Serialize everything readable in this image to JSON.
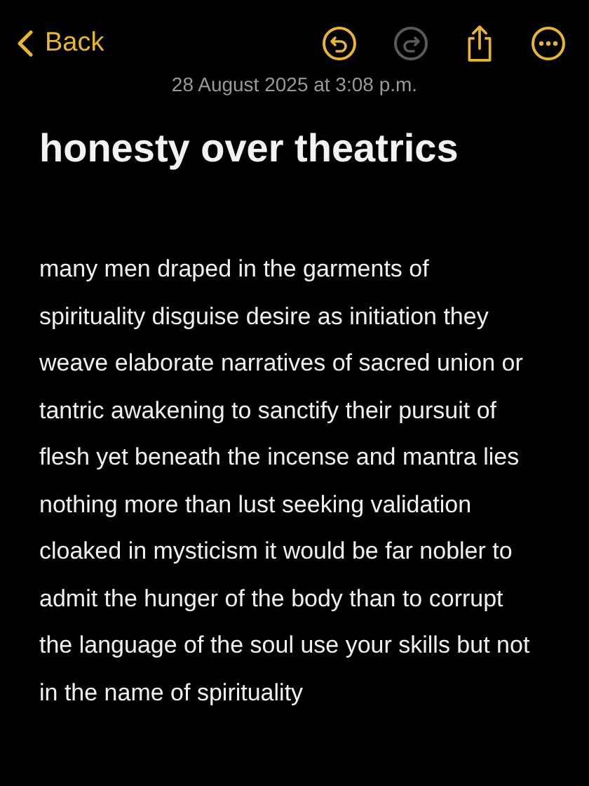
{
  "nav": {
    "back": "Back",
    "tools": [
      {
        "kind": "undo",
        "disabled": false
      },
      {
        "kind": "redo",
        "disabled": true
      },
      {
        "kind": "share",
        "disabled": false
      },
      {
        "kind": "more",
        "disabled": false
      }
    ]
  },
  "note": {
    "date": "28 August 2025 at 3:08 p.m.",
    "title": "honesty over theatrics",
    "body": "many men draped in the garments of spirituality disguise desire as initiation they weave elaborate narratives of sacred union or tantric awakening to sanctify their pursuit of flesh yet beneath the incense and mantra lies nothing more than lust seeking validation cloaked in mysticism it would be far nobler to admit the hunger of the body than to corrupt the language of the soul use your skills but not in the name of spirituality"
  }
}
